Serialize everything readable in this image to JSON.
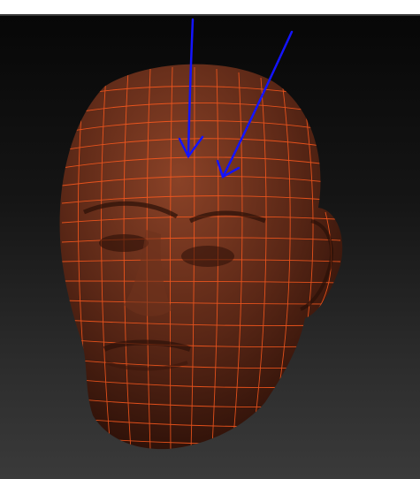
{
  "window": {
    "title": ""
  },
  "viewport": {
    "model": "sculpted-head-mesh",
    "wireframe_overlay": true,
    "colors": {
      "background_top": "#070707",
      "background_bottom": "#3a3a3a",
      "mesh_base": "#5a2716",
      "mesh_highlight": "#8a4227",
      "wireframe": "#ff5a1e",
      "annotation_arrows": "#1414ff"
    },
    "annotations": [
      {
        "type": "arrow",
        "color": "#1414ff",
        "points_to": "forehead-edge-loops"
      },
      {
        "type": "arrow",
        "color": "#1414ff",
        "points_to": "forehead-edge-loops"
      }
    ]
  }
}
